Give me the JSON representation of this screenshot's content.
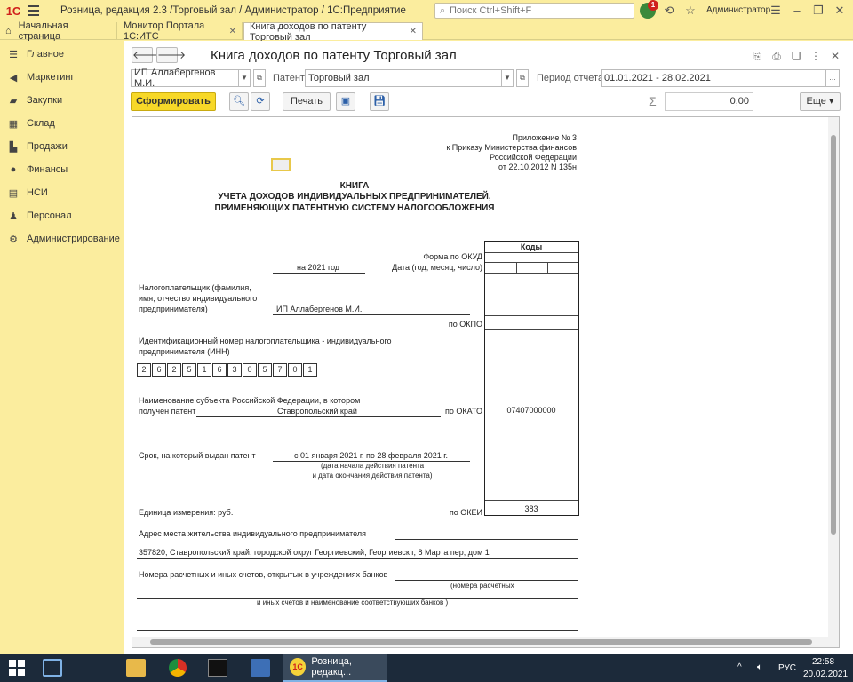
{
  "titlebar": {
    "logo": "1С",
    "title": "Розница, редакция 2.3 /Торговый зал / Администратор / 1С:Предприятие",
    "search_placeholder": "Поиск Ctrl+Shift+F",
    "notification_count": "1",
    "user": "Администратор"
  },
  "tabs": [
    {
      "label": "Начальная страница"
    },
    {
      "label": "Монитор Портала 1С:ИТС"
    },
    {
      "label": "Книга доходов по патенту Торговый зал"
    }
  ],
  "sidebar": {
    "items": [
      {
        "label": "Главное",
        "icon": "list-icon"
      },
      {
        "label": "Маркетинг",
        "icon": "megaphone-icon"
      },
      {
        "label": "Закупки",
        "icon": "truck-icon"
      },
      {
        "label": "Склад",
        "icon": "warehouse-icon"
      },
      {
        "label": "Продажи",
        "icon": "cart-icon"
      },
      {
        "label": "Финансы",
        "icon": "coin-icon"
      },
      {
        "label": "НСИ",
        "icon": "directory-icon"
      },
      {
        "label": "Персонал",
        "icon": "person-icon"
      },
      {
        "label": "Администрирование",
        "icon": "gear-icon"
      }
    ]
  },
  "form": {
    "title": "Книга доходов по патенту Торговый зал",
    "org_value": "ИП Аллабергенов М.И.",
    "patent_label": "Патент:",
    "patent_value": "Торговый зал",
    "period_label": "Период отчета:",
    "period_value": "01.01.2021 - 28.02.2021",
    "generate_label": "Сформировать",
    "print_label": "Печать",
    "sum_value": "0,00",
    "more_label": "Еще"
  },
  "report": {
    "appendix": [
      "Приложение № 3",
      "к Приказу Министерства финансов",
      "Российской Федерации",
      "от 22.10.2012 N 135н"
    ],
    "title_lines": [
      "КНИГА",
      "УЧЕТА ДОХОДОВ ИНДИВИДУАЛЬНЫХ ПРЕДПРИНИМАТЕЛЕЙ,",
      "ПРИМЕНЯЮЩИХ ПАТЕНТНУЮ СИСТЕМУ НАЛОГООБЛОЖЕНИЯ"
    ],
    "codes_header": "Коды",
    "okud_label": "Форма по ОКУД",
    "date_label": "Дата (год, месяц, число)",
    "year_text": "на 2021 год",
    "taxpayer_label": [
      "Налогоплательщик (фамилия,",
      "имя, отчество индивидуального",
      "предпринимателя)"
    ],
    "taxpayer_value": "ИП Аллабергенов М.И.",
    "okpo_label": "по ОКПО",
    "inn_label": [
      "Идентификационный номер налогоплательщика - индивидуального",
      "предпринимателя (ИНН)"
    ],
    "inn_digits": [
      "2",
      "6",
      "2",
      "5",
      "1",
      "6",
      "3",
      "0",
      "5",
      "7",
      "0",
      "1"
    ],
    "region_label": [
      "Наименование субъекта Российской Федерации, в котором",
      "получен патент"
    ],
    "region_value": "Ставропольский край",
    "okato_label": "по ОКАТО",
    "okato_value": "07407000000",
    "term_label": "Срок, на который выдан патент",
    "term_value": "с 01 января 2021 г. по 28 февраля 2021 г.",
    "term_hint": [
      "(дата начала действия патента",
      "и дата окончания действия патента)"
    ],
    "unit_label": "Единица измерения:   руб.",
    "okei_label": "по ОКЕИ",
    "okei_value": "383",
    "address_label": "Адрес места жительства индивидуального предпринимателя",
    "address_value": "357820, Ставропольский край, городской округ Георгиевский, Георгиевск г, 8 Марта пер, дом 1",
    "accounts_label": "Номера расчетных и иных счетов, открытых в учреждениях банков",
    "accounts_hint1": "(номера расчетных",
    "accounts_hint2": "и иных счетов и наименование соответствующих банков )"
  },
  "taskbar": {
    "active_app": "Розница, редакц...",
    "lang": "РУС",
    "time": "22:58",
    "date": "20.02.2021"
  }
}
